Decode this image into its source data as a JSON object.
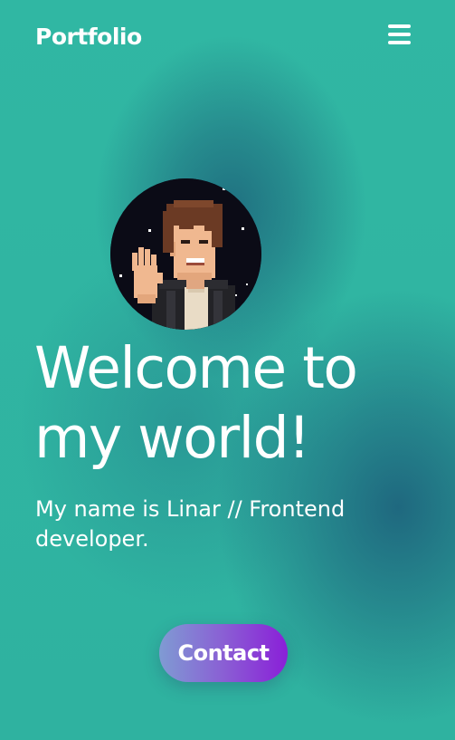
{
  "header": {
    "logo": "Portfolio",
    "menu_icon": "hamburger-menu-icon"
  },
  "hero": {
    "avatar_icon": "pixel-art-avatar-waving",
    "title_line1": "Welcome to",
    "title_line2": "my world!",
    "subtitle": "My name is Linar // Frontend developer.",
    "contact_label": "Contact"
  },
  "colors": {
    "background": "#2fb5a2",
    "background_shade": "#1e6a7d",
    "button_gradient_start": "#7f9bd3",
    "button_gradient_end": "#8a1fd8",
    "text": "#ffffff"
  }
}
